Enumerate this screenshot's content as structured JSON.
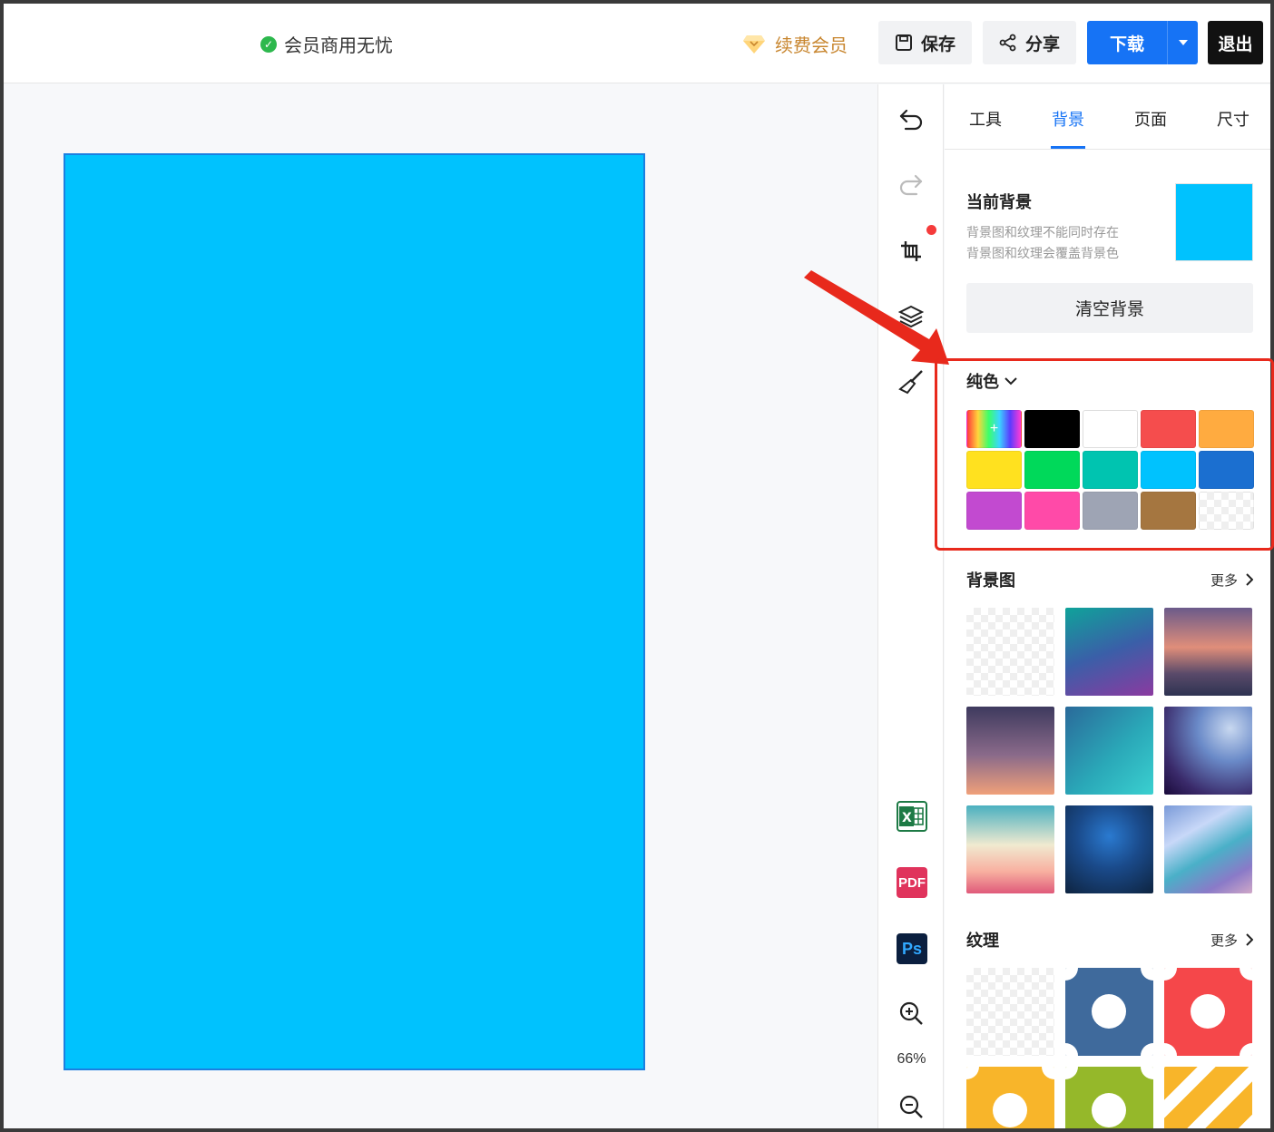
{
  "topbar": {
    "member_label": "会员商用无忧",
    "renew_label": "续费会员",
    "save_label": "保存",
    "share_label": "分享",
    "download_label": "下载",
    "exit_label": "退出"
  },
  "canvas": {
    "page_background": "#00c2fe"
  },
  "toolbar": {
    "icons": [
      "undo-icon",
      "redo-icon",
      "crop-icon",
      "layers-icon",
      "brush-icon",
      "excel-icon",
      "pdf-icon",
      "ps-icon",
      "zoom-in-icon",
      "zoom-out-icon"
    ],
    "pdf_label": "PDF",
    "ps_label": "Ps",
    "zoom_level": "66%"
  },
  "panel": {
    "tabs": [
      {
        "label": "工具"
      },
      {
        "label": "背景"
      },
      {
        "label": "页面"
      },
      {
        "label": "尺寸"
      }
    ],
    "active_tab": "背景",
    "current_bg": {
      "title": "当前背景",
      "note1": "背景图和纹理不能同时存在",
      "note2": "背景图和纹理会覆盖背景色",
      "color": "#00c2fe",
      "clear_label": "清空背景"
    },
    "solid": {
      "title": "纯色",
      "add_symbol": "+",
      "colors": [
        "rainbow",
        "#000000",
        "#ffffff",
        "#f54d4d",
        "#ffab40",
        "#ffe11f",
        "#00d95a",
        "#00c4b0",
        "#00c2fe",
        "#1b6fd0",
        "#c24ad0",
        "#ff4aa8",
        "#9ea4b4",
        "#a57640",
        "transparent"
      ]
    },
    "bg_images": {
      "title": "背景图",
      "more_label": "更多"
    },
    "textures": {
      "title": "纹理",
      "more_label": "更多"
    }
  },
  "annotation": {
    "highlight_color": "#e8291c"
  }
}
